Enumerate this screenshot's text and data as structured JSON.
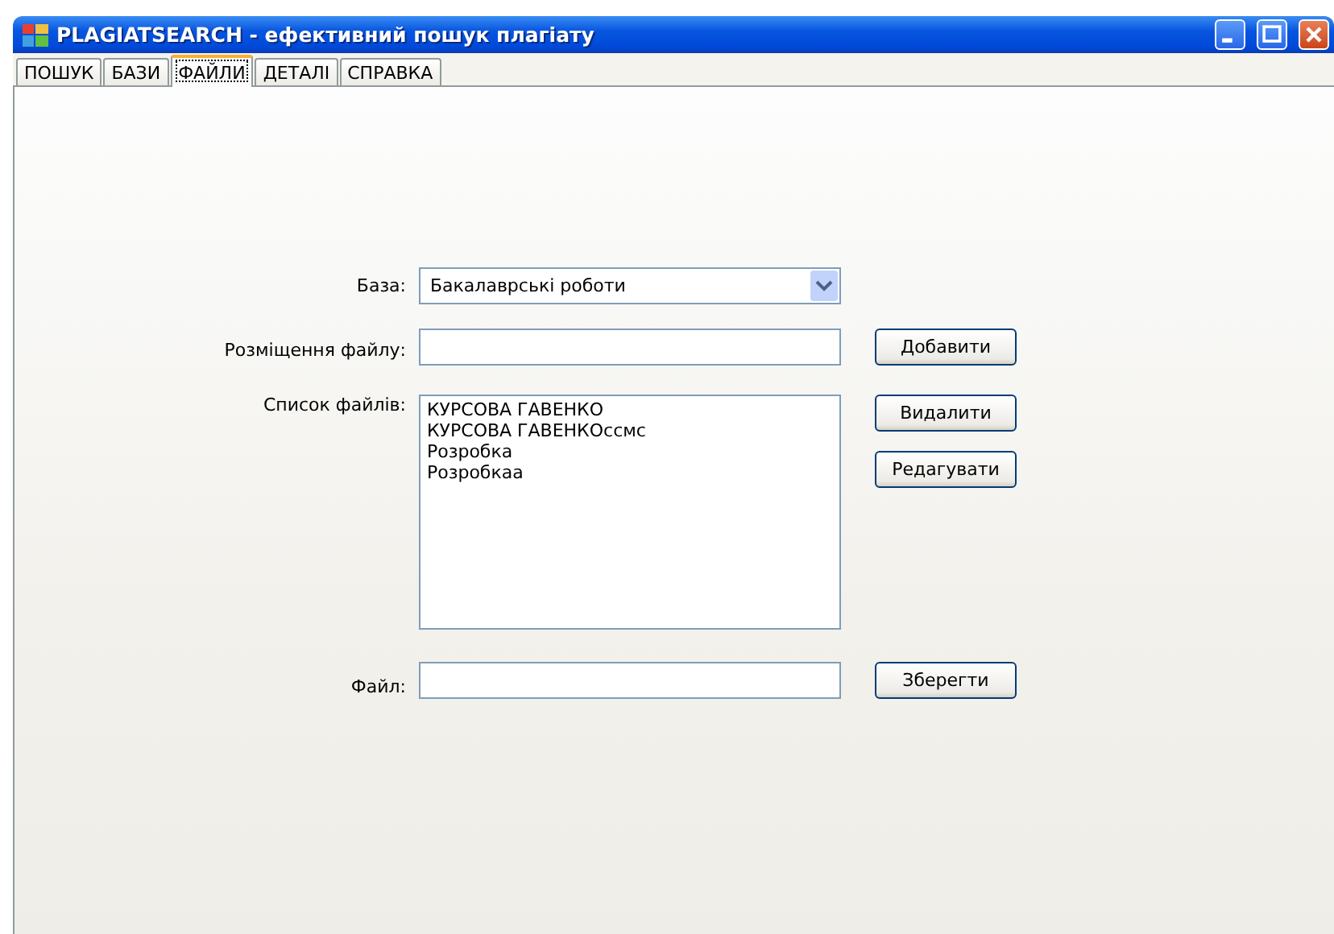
{
  "window": {
    "title": "PLAGIATSEARCH - ефективний пошук плагіату"
  },
  "tabs": [
    {
      "label": "ПОШУК",
      "selected": false
    },
    {
      "label": "БАЗИ",
      "selected": false
    },
    {
      "label": "ФАЙЛИ",
      "selected": true
    },
    {
      "label": "ДЕТАЛІ",
      "selected": false
    },
    {
      "label": "СПРАВКА",
      "selected": false
    }
  ],
  "form": {
    "base_label": "База:",
    "base_value": "Бакалаврські роботи",
    "location_label": "Розміщення файлу:",
    "add_button": "Добавити",
    "list_label": "Список файлів:",
    "files": [
      "КУРСОВА ГАВЕНКО",
      "КУРСОВА ГАВЕНКОccмc",
      "Розробка",
      "Розробкаа"
    ],
    "delete_button": "Видалити",
    "edit_button": "Редагувати",
    "file_label": "Файл:",
    "save_button": "Зберегти"
  }
}
